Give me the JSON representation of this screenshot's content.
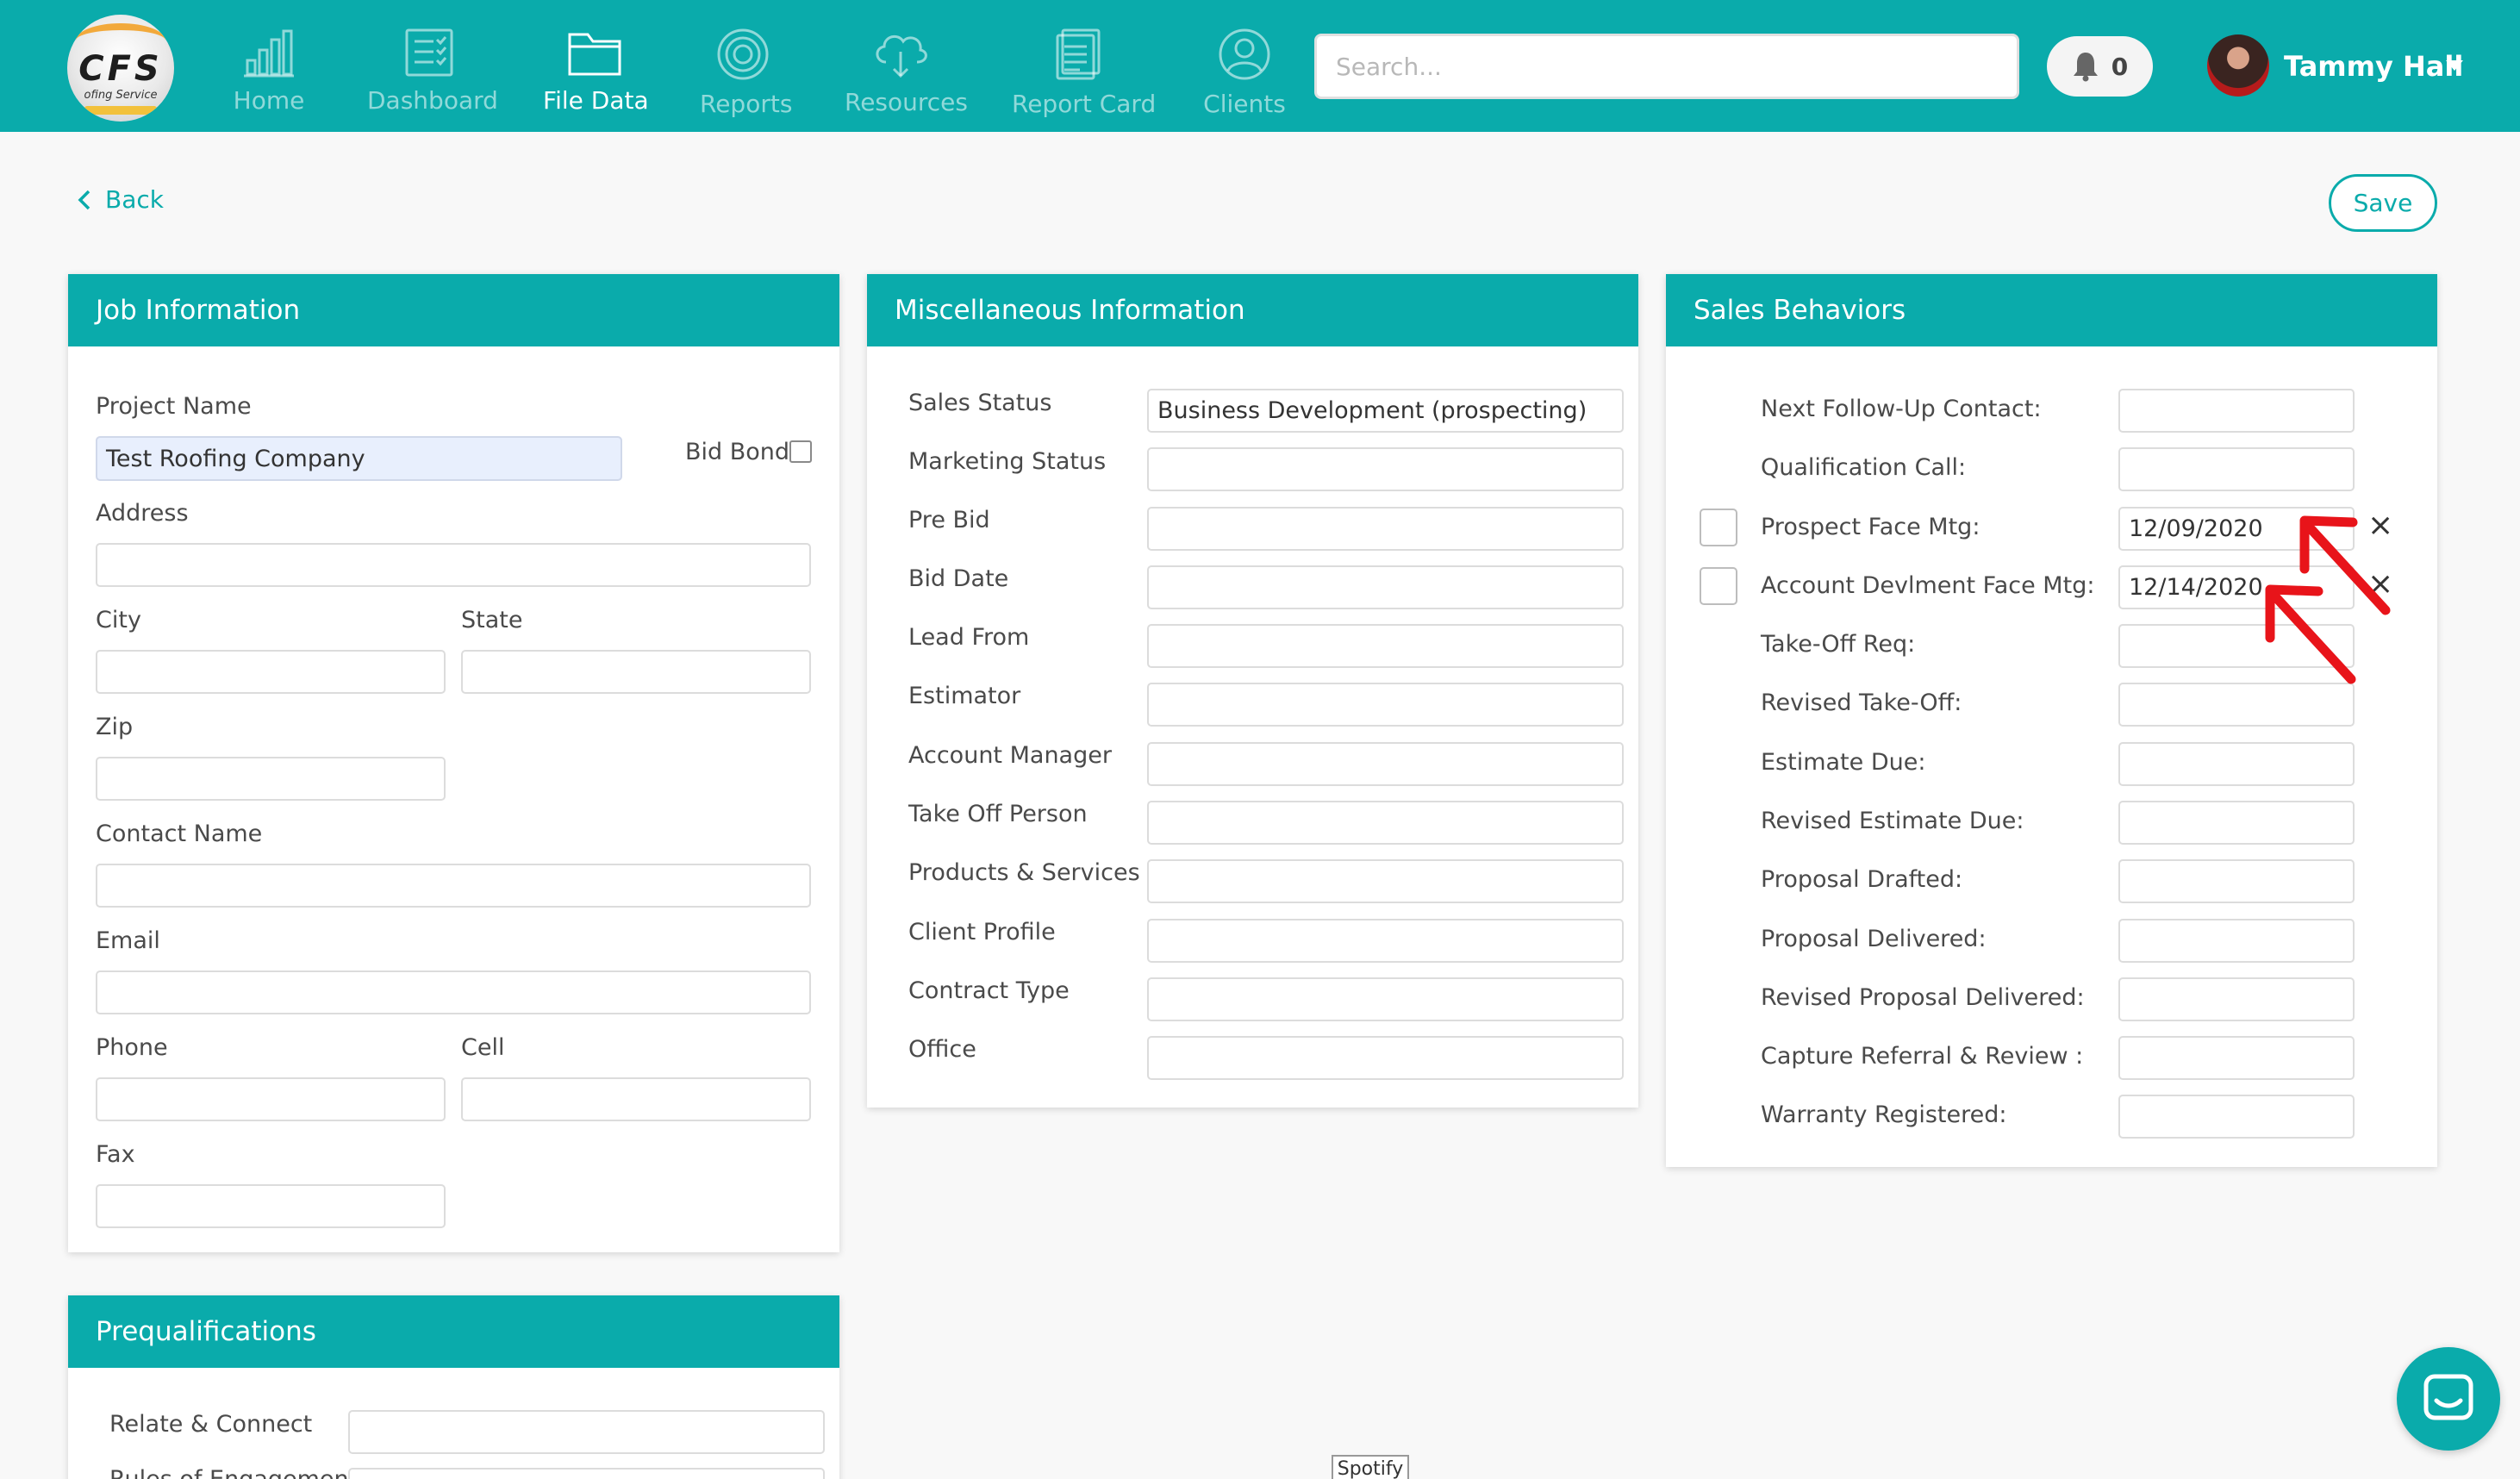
{
  "app": {
    "logo_text": "CFS",
    "logo_sub": "ofing Service",
    "brand_color": "#0aabab",
    "accent_arrow_color": "#e8141a"
  },
  "nav": {
    "items": [
      {
        "label": "Home",
        "icon": "bar-chart-icon"
      },
      {
        "label": "Dashboard",
        "icon": "checklist-icon"
      },
      {
        "label": "File Data",
        "icon": "folder-icon",
        "active": true
      },
      {
        "label": "Reports",
        "icon": "target-icon"
      },
      {
        "label": "Resources",
        "icon": "cloud-download-icon"
      },
      {
        "label": "Report Card",
        "icon": "document-icon"
      },
      {
        "label": "Clients",
        "icon": "user-circle-icon"
      }
    ],
    "search_placeholder": "Search...",
    "notification_count": "0",
    "user_name": "Tammy Hall"
  },
  "toolbar": {
    "back_label": "Back",
    "save_label": "Save"
  },
  "job_info": {
    "title": "Job Information",
    "project_name_label": "Project Name",
    "project_name_value": "Test Roofing Company",
    "bid_bond_label": "Bid Bond",
    "address_label": "Address",
    "city_label": "City",
    "state_label": "State",
    "zip_label": "Zip",
    "contact_name_label": "Contact Name",
    "email_label": "Email",
    "phone_label": "Phone",
    "cell_label": "Cell",
    "fax_label": "Fax"
  },
  "misc_info": {
    "title": "Miscellaneous Information",
    "fields": [
      {
        "label": "Sales Status",
        "value": "Business Development (prospecting)"
      },
      {
        "label": "Marketing Status",
        "value": ""
      },
      {
        "label": "Pre Bid",
        "value": ""
      },
      {
        "label": "Bid Date",
        "value": ""
      },
      {
        "label": "Lead From",
        "value": ""
      },
      {
        "label": "Estimator",
        "value": ""
      },
      {
        "label": "Account Manager",
        "value": ""
      },
      {
        "label": "Take Off Person",
        "value": ""
      },
      {
        "label": "Products & Services",
        "value": ""
      },
      {
        "label": "Client Profile",
        "value": ""
      },
      {
        "label": "Contract Type",
        "value": ""
      },
      {
        "label": "Office",
        "value": ""
      }
    ]
  },
  "sales_behaviors": {
    "title": "Sales Behaviors",
    "fields": [
      {
        "label": "Next Follow-Up Contact:",
        "value": ""
      },
      {
        "label": "Qualification Call:",
        "value": ""
      },
      {
        "label": "Prospect Face Mtg:",
        "value": "12/09/2020",
        "checkbox": true,
        "clear": "×"
      },
      {
        "label": "Account Devlment Face Mtg:",
        "value": "12/14/2020",
        "checkbox": true,
        "clear": "×"
      },
      {
        "label": "Take-Off Req:",
        "value": ""
      },
      {
        "label": "Revised Take-Off:",
        "value": ""
      },
      {
        "label": "Estimate Due:",
        "value": ""
      },
      {
        "label": "Revised Estimate Due:",
        "value": ""
      },
      {
        "label": "Proposal Drafted:",
        "value": ""
      },
      {
        "label": "Proposal Delivered:",
        "value": ""
      },
      {
        "label": "Revised Proposal Delivered:",
        "value": ""
      },
      {
        "label": "Capture Referral & Review :",
        "value": ""
      },
      {
        "label": "Warranty Registered:",
        "value": ""
      }
    ]
  },
  "prequal": {
    "title": "Prequalifications",
    "fields": [
      {
        "label": "Relate & Connect",
        "value": ""
      },
      {
        "label": "Rules of Engagement",
        "value": ""
      }
    ]
  },
  "footer": {
    "spotify_label": "Spotify"
  }
}
